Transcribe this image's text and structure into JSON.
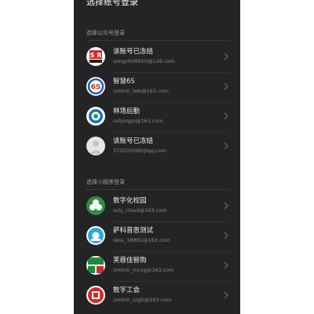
{
  "page_title": "选择账号登录",
  "sections": [
    {
      "label": "选择公众号登录",
      "accounts": [
        {
          "name": "该账号已冻结",
          "email": "songch08910@126.com",
          "avatar": "sr-logo-icon"
        },
        {
          "name": "智慧6S",
          "email": "zmlmli_lwb@163.com",
          "avatar": "6s-logo-icon"
        },
        {
          "name": "林场后勤",
          "email": "sxlyxqgx@163.com",
          "avatar": "emblem-logo-icon"
        },
        {
          "name": "该账号已冻结",
          "email": "372032096@qq.com",
          "avatar": "default-user-icon"
        }
      ]
    },
    {
      "label": "选择小程序登录",
      "accounts": [
        {
          "name": "数字化校园",
          "email": "sxly_cloud@163.com",
          "avatar": "campus-logo-icon"
        },
        {
          "name": "萨科普思测试",
          "email": "skss_18881@163.com",
          "avatar": "blue-circle-logo-icon"
        },
        {
          "name": "芙蓉佳智购",
          "email": "zmlmli_mcyg@163.com",
          "avatar": "shop-logo-icon"
        },
        {
          "name": "数字工会",
          "email": "zmlmli_szgh@163.com",
          "avatar": "union-logo-icon"
        }
      ]
    }
  ],
  "colors": {
    "panel_bg": "#242424",
    "text": "#f0f0f0",
    "muted": "#8a8a8a"
  }
}
